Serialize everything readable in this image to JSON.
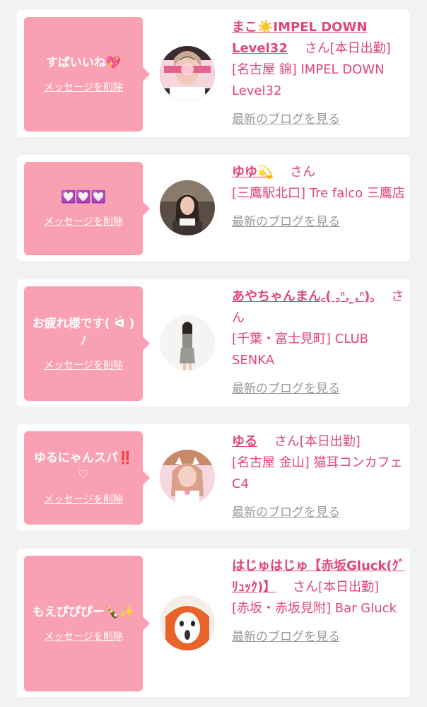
{
  "delete_label": "メッセージを削除",
  "blog_label": "最新のブログを見る",
  "honorific": "さん",
  "colors": {
    "accent": "#e0457b",
    "bubble": "#f9a0b2",
    "link_gray": "#9a9a9a"
  },
  "cards": [
    {
      "message": "すばいいね💖",
      "name": "まこ☀️IMPEL DOWN Level32",
      "status": "[本日出勤]",
      "shop": "[名古屋 錦] IMPEL DOWN Level32",
      "avatar_icon": "profile-photo-icon"
    },
    {
      "message": "💟💟💟",
      "name": "ゆゆ💫",
      "status": "",
      "shop": "[三鷹駅北口] Tre falco 三鷹店",
      "avatar_icon": "profile-photo-icon"
    },
    {
      "message": "お疲れ様です( ᐛ )ﾉ",
      "name": "あやちゃんまん꜀( ꜆ᐢ. ̫.ᐢ)꜆",
      "status": "",
      "shop": "[千葉・富士見町] CLUB SENKA",
      "avatar_icon": "profile-photo-icon"
    },
    {
      "message": "ゆるにゃんスパ‼️♡",
      "name": "ゆる",
      "status": "[本日出勤]",
      "shop": "[名古屋 金山] 猫耳コンカフェ C4",
      "avatar_icon": "profile-photo-icon"
    },
    {
      "message": "もえぴぴぴー🍾✨",
      "name": "はじゅはじゅ【赤坂Gluck(ｸﾞﾘｭｯｸ)】",
      "status": "[本日出勤]",
      "shop": "[赤坂・赤坂見附] Bar Gluck",
      "avatar_icon": "profile-photo-icon"
    }
  ]
}
